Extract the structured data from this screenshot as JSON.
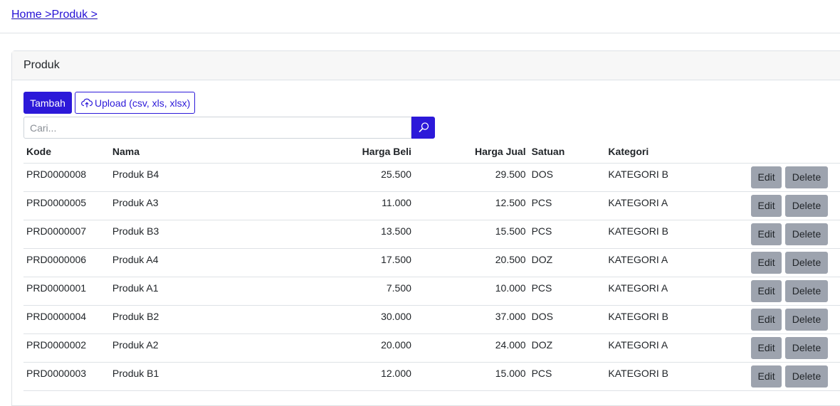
{
  "breadcrumb": {
    "home": "Home >",
    "produk": "Produk >"
  },
  "card": {
    "title": "Produk"
  },
  "toolbar": {
    "add_label": "Tambah",
    "upload_label": "Upload (csv, xls, xlsx)"
  },
  "search": {
    "placeholder": "Cari..."
  },
  "table": {
    "headers": {
      "kode": "Kode",
      "nama": "Nama",
      "harga_beli": "Harga Beli",
      "harga_jual": "Harga Jual",
      "satuan": "Satuan",
      "kategori": "Kategori"
    },
    "rows": [
      {
        "kode": "PRD0000008",
        "nama": "Produk B4",
        "harga_beli": "25.500",
        "harga_jual": "29.500",
        "satuan": "DOS",
        "kategori": "KATEGORI B",
        "edit": "Edit",
        "delete": "Delete"
      },
      {
        "kode": "PRD0000005",
        "nama": "Produk A3",
        "harga_beli": "11.000",
        "harga_jual": "12.500",
        "satuan": "PCS",
        "kategori": "KATEGORI A",
        "edit": "Edit",
        "delete": "Delete"
      },
      {
        "kode": "PRD0000007",
        "nama": "Produk B3",
        "harga_beli": "13.500",
        "harga_jual": "15.500",
        "satuan": "PCS",
        "kategori": "KATEGORI B",
        "edit": "Edit",
        "delete": "Delete"
      },
      {
        "kode": "PRD0000006",
        "nama": "Produk A4",
        "harga_beli": "17.500",
        "harga_jual": "20.500",
        "satuan": "DOZ",
        "kategori": "KATEGORI A",
        "edit": "Edit",
        "delete": "Delete"
      },
      {
        "kode": "PRD0000001",
        "nama": "Produk A1",
        "harga_beli": "7.500",
        "harga_jual": "10.000",
        "satuan": "PCS",
        "kategori": "KATEGORI A",
        "edit": "Edit",
        "delete": "Delete"
      },
      {
        "kode": "PRD0000004",
        "nama": "Produk B2",
        "harga_beli": "30.000",
        "harga_jual": "37.000",
        "satuan": "DOS",
        "kategori": "KATEGORI B",
        "edit": "Edit",
        "delete": "Delete"
      },
      {
        "kode": "PRD0000002",
        "nama": "Produk A2",
        "harga_beli": "20.000",
        "harga_jual": "24.000",
        "satuan": "DOZ",
        "kategori": "KATEGORI A",
        "edit": "Edit",
        "delete": "Delete"
      },
      {
        "kode": "PRD0000003",
        "nama": "Produk B1",
        "harga_beli": "12.000",
        "harga_jual": "15.000",
        "satuan": "PCS",
        "kategori": "KATEGORI B",
        "edit": "Edit",
        "delete": "Delete"
      }
    ]
  },
  "icons": {
    "upload": "cloud-upload-icon",
    "search": "search-icon"
  },
  "colors": {
    "primary": "#2c19d9",
    "action_button": "#9da3ae",
    "link": "#1a0dab"
  }
}
